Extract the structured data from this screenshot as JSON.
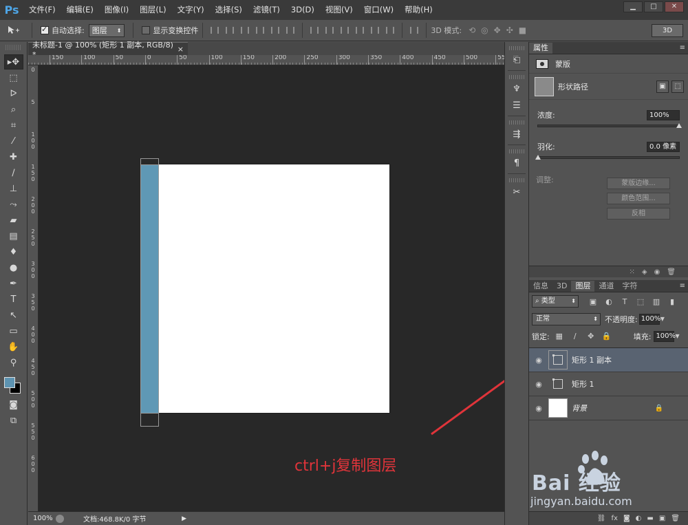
{
  "app": {
    "logo": "Ps"
  },
  "menu": [
    "文件(F)",
    "编辑(E)",
    "图像(I)",
    "图层(L)",
    "文字(Y)",
    "选择(S)",
    "滤镜(T)",
    "3D(D)",
    "视图(V)",
    "窗口(W)",
    "帮助(H)"
  ],
  "window_controls": {
    "minimize": "▁",
    "restore": "□",
    "close": "✕"
  },
  "options": {
    "auto_select_label": "自动选择:",
    "auto_select_checked": true,
    "auto_select_target": "图层",
    "show_transform_label": "显示变换控件",
    "show_transform_checked": false,
    "mode_3d_label": "3D 模式:",
    "mode_3d_button": "3D"
  },
  "document": {
    "tab_title": "未标题-1 @ 100% (矩形 1 副本, RGB/8) *",
    "tab_close": "×",
    "ruler_h_ticks": [
      "150",
      "100",
      "50",
      "0",
      "50",
      "100",
      "150",
      "200",
      "250",
      "300",
      "350",
      "400",
      "450",
      "500",
      "55"
    ],
    "ruler_v_ticks": [
      "0",
      "5",
      "1\n0\n0",
      "1\n5\n0",
      "2\n0\n0",
      "2\n5\n0",
      "3\n0\n0",
      "3\n5\n0",
      "4\n0\n0",
      "4\n5\n0",
      "5\n0\n0",
      "5\n5\n0",
      "6\n0\n0"
    ],
    "rect_color": "#5f98b5",
    "annotation": "ctrl+j复制图层",
    "annotation_color": "#e0343a"
  },
  "status": {
    "zoom": "100%",
    "doc_info": "文档:468.8K/0 字节"
  },
  "colors": {
    "foreground": "#5d93b1",
    "background": "#000000"
  },
  "properties": {
    "tab": "属性",
    "section": "蒙版",
    "shape_label": "形状路径",
    "density_label": "浓度:",
    "density_value": "100%",
    "density_level": 1.0,
    "feather_label": "羽化:",
    "feather_value": "0.0 像素",
    "feather_level": 0.0,
    "adjust_label": "调整:",
    "buttons": [
      "蒙版边缘...",
      "颜色范围...",
      "反相"
    ]
  },
  "layers_panel": {
    "tabs": [
      "信息",
      "3D",
      "图层",
      "通道",
      "字符"
    ],
    "active_tab": "图层",
    "filter_type": "类型",
    "blend_mode": "正常",
    "opacity_label": "不透明度:",
    "opacity_value": "100%",
    "lock_label": "锁定:",
    "fill_label": "填充:",
    "fill_value": "100%",
    "layers": [
      {
        "name": "矩形 1 副本",
        "type": "vector",
        "selected": true
      },
      {
        "name": "矩形 1",
        "type": "vector",
        "selected": false
      },
      {
        "name": "背景",
        "type": "background",
        "selected": false,
        "locked": true
      }
    ]
  },
  "watermark": {
    "brand": "Bai 经验",
    "url": "jingyan.baidu.com"
  }
}
